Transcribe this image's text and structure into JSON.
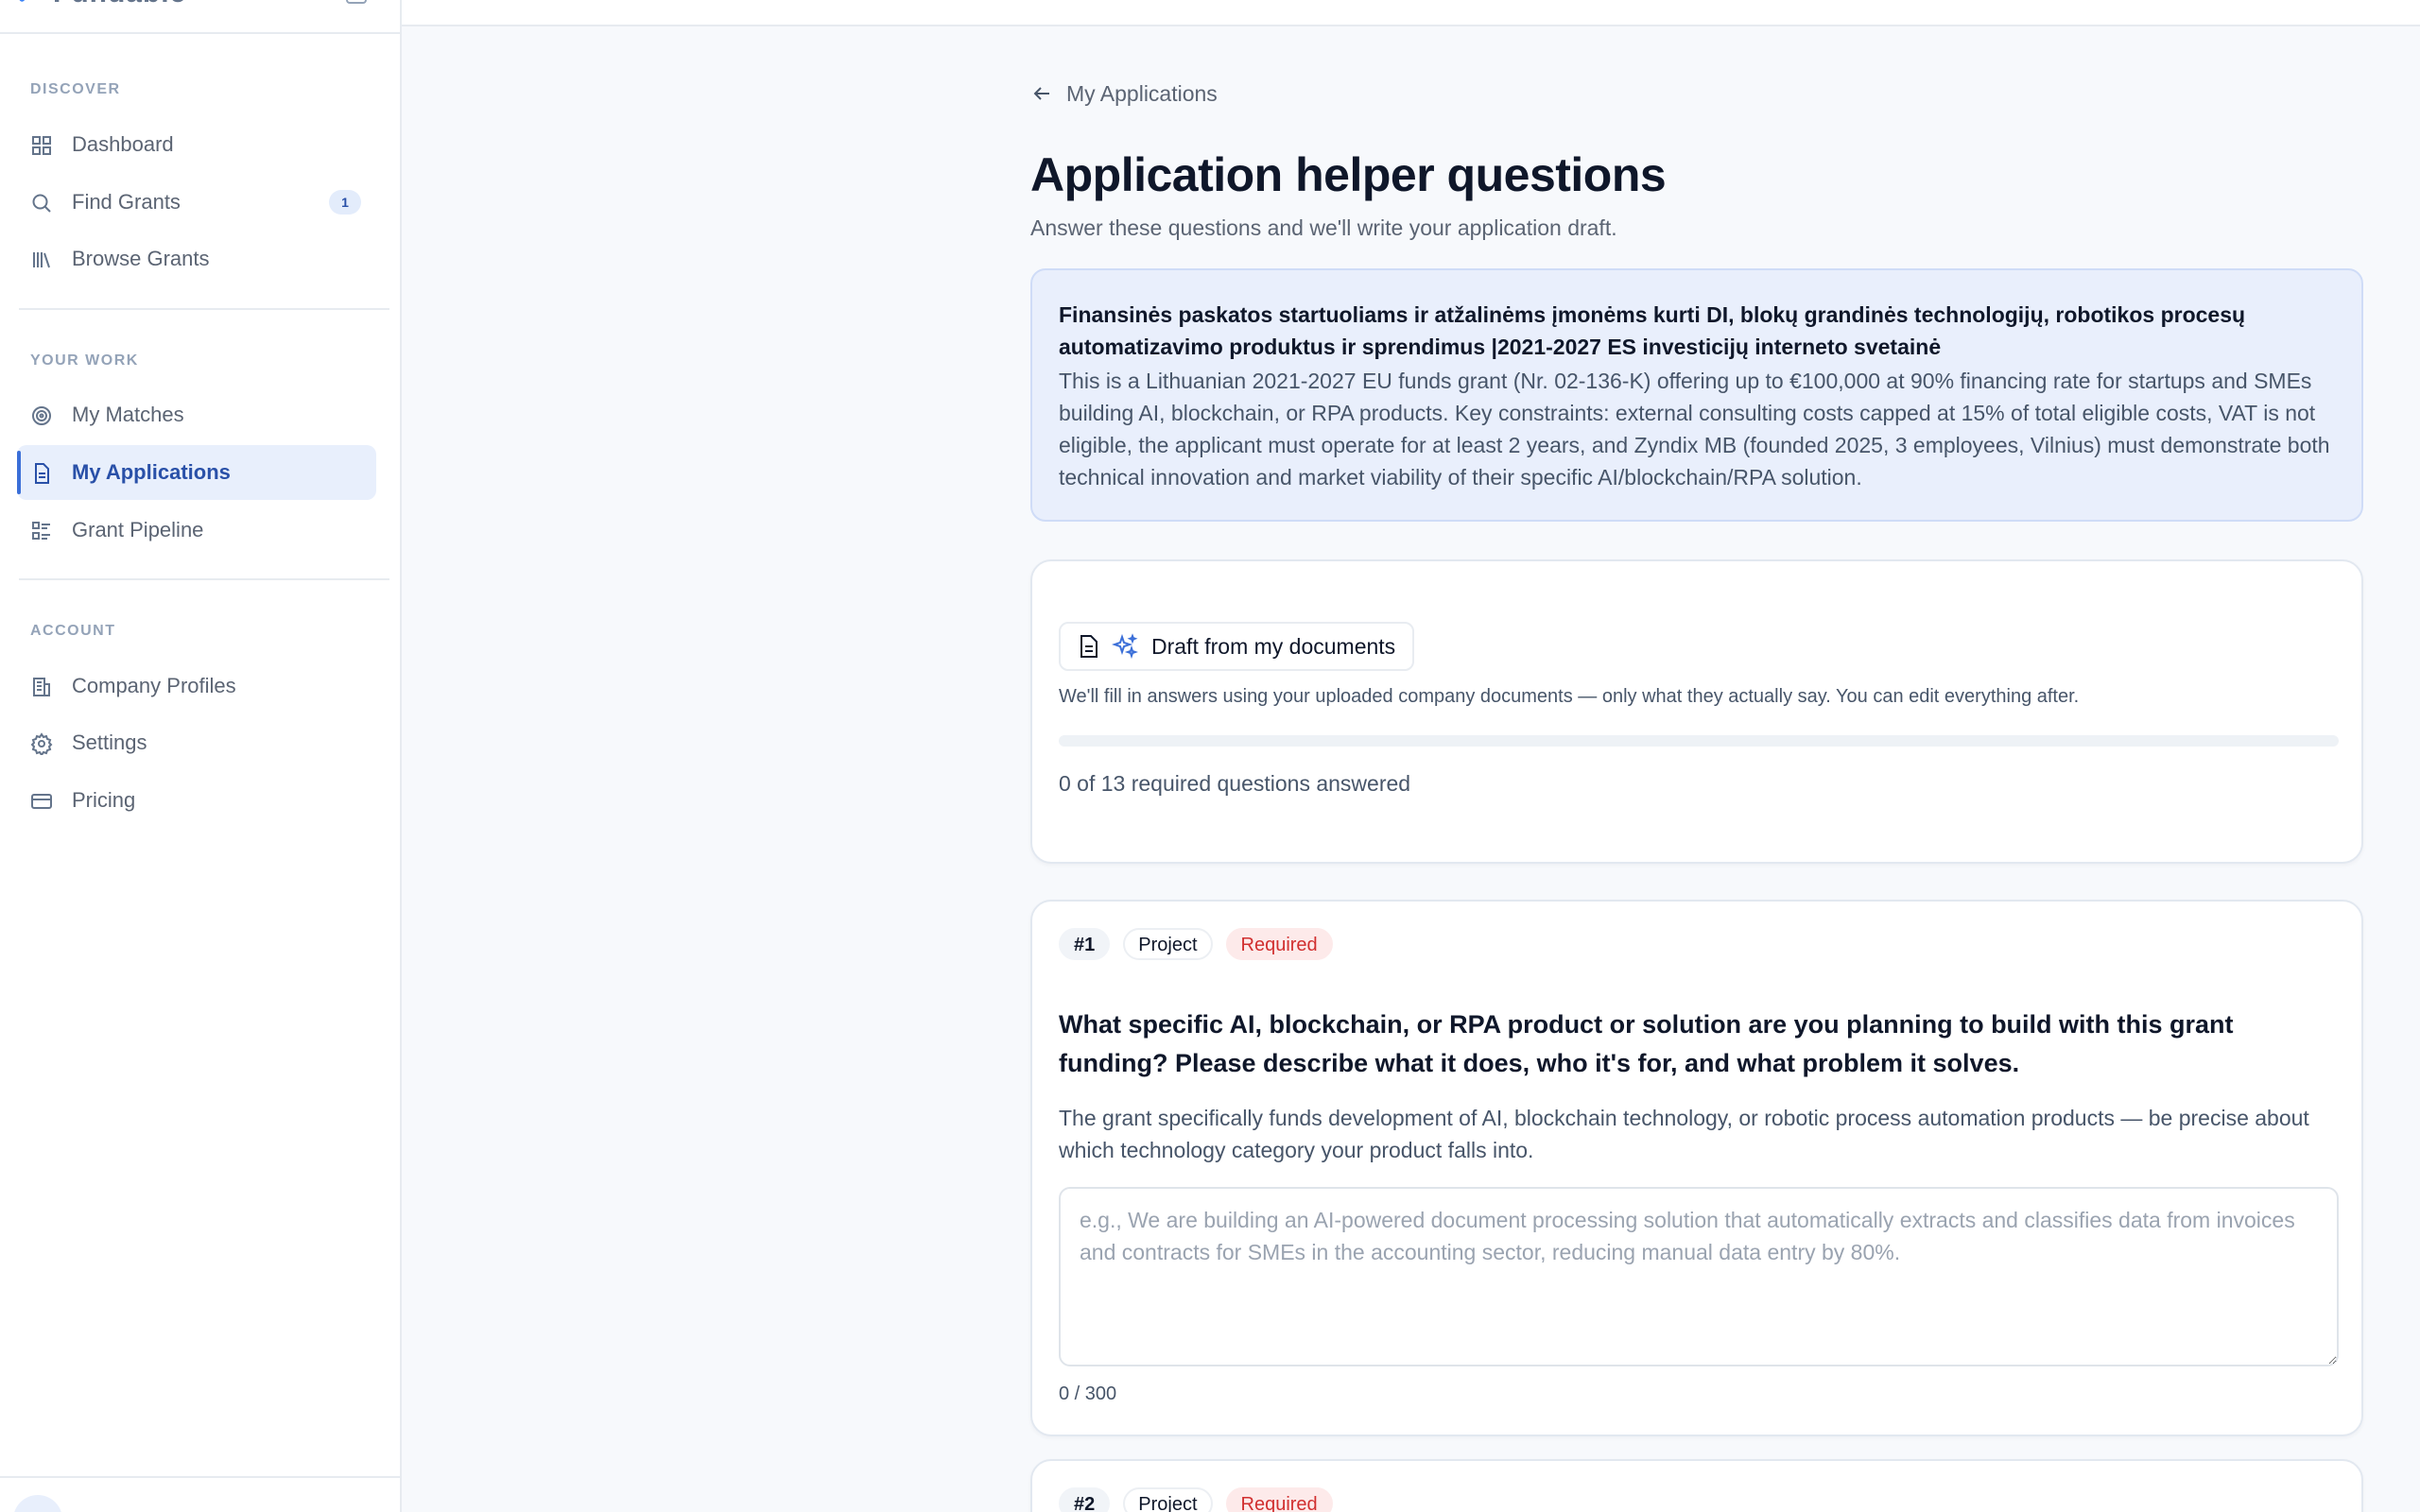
{
  "brand": {
    "name": "Fundable"
  },
  "sidebar": {
    "sections": [
      {
        "label": "DISCOVER"
      },
      {
        "label": "YOUR WORK"
      },
      {
        "label": "ACCOUNT"
      }
    ],
    "items": [
      {
        "label": "Dashboard",
        "icon": "grid-icon"
      },
      {
        "label": "Find Grants",
        "icon": "search-icon",
        "badge": "1"
      },
      {
        "label": "Browse Grants",
        "icon": "library-icon"
      },
      {
        "label": "My Matches",
        "icon": "target-icon"
      },
      {
        "label": "My Applications",
        "icon": "document-icon",
        "active": true
      },
      {
        "label": "Grant Pipeline",
        "icon": "list-icon"
      },
      {
        "label": "Company Profiles",
        "icon": "building-icon"
      },
      {
        "label": "Settings",
        "icon": "gear-icon"
      },
      {
        "label": "Pricing",
        "icon": "card-icon"
      }
    ]
  },
  "main": {
    "back_label": "My Applications",
    "title": "Application helper questions",
    "subtitle": "Answer these questions and we'll write your application draft.",
    "grant": {
      "title": "Finansinės paskatos startuoliams ir atžalinėms įmonėms kurti DI, blokų grandinės technologijų, robotikos procesų automatizavimo produktus ir sprendimus |2021-2027 ES investicijų interneto svetainė",
      "description": "This is a Lithuanian 2021-2027 EU funds grant (Nr. 02-136-K) offering up to €100,000 at 90% financing rate for startups and SMEs building AI, blockchain, or RPA products. Key constraints: external consulting costs capped at 15% of total eligible costs, VAT is not eligible, the applicant must operate for at least 2 years, and Zyndix MB (founded 2025, 3 employees, Vilnius) must demonstrate both technical innovation and market viability of their specific AI/blockchain/RPA solution."
    },
    "draft": {
      "button_label": "Draft from my documents",
      "note": "We'll fill in answers using your uploaded company documents — only what they actually say. You can edit everything after.",
      "progress_fraction": 0,
      "progress_text": "0 of 13 required questions answered"
    },
    "questions": [
      {
        "number": "#1",
        "category": "Project",
        "required_label": "Required",
        "title": "What specific AI, blockchain, or RPA product or solution are you planning to build with this grant funding? Please describe what it does, who it's for, and what problem it solves.",
        "help": "The grant specifically funds development of AI, blockchain technology, or robotic process automation products — be precise about which technology category your product falls into.",
        "placeholder": "e.g., We are building an AI-powered document processing solution that automatically extracts and classifies data from invoices and contracts for SMEs in the accounting sector, reducing manual data entry by 80%.",
        "value": "",
        "counter": "0 / 300"
      },
      {
        "number": "#2",
        "category": "Project",
        "required_label": "Required"
      }
    ]
  },
  "colors": {
    "accent": "#3b6fd8",
    "required": "#d12f2f",
    "grant_bg": "#e9effc"
  }
}
